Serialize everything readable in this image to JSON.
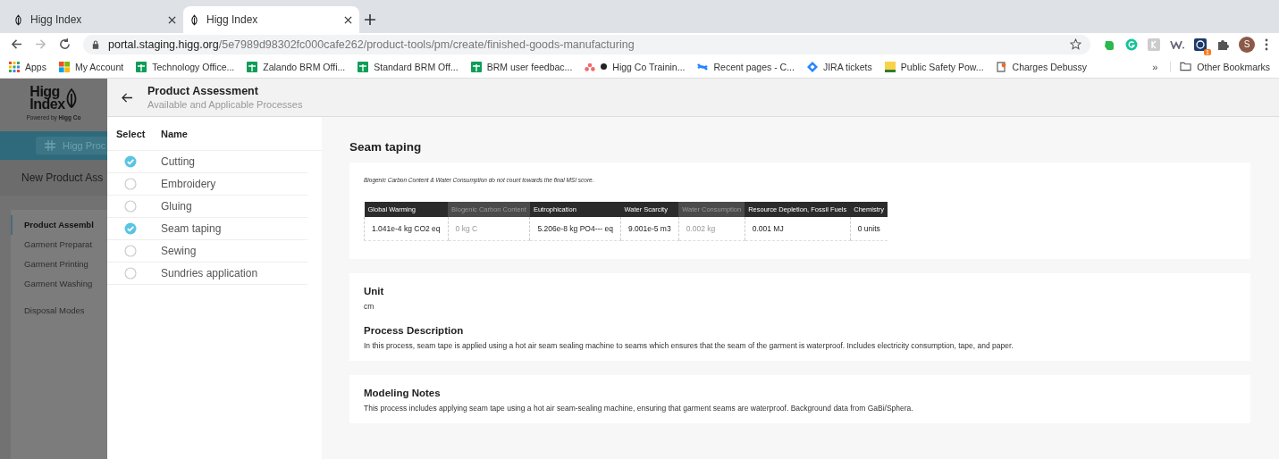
{
  "browser": {
    "tabs": [
      {
        "title": "Higg Index",
        "selected": false
      },
      {
        "title": "Higg Index",
        "selected": true
      }
    ],
    "url_host": "portal.staging.higg.org",
    "url_path": "/5e7989d98302fc000cafe262/product-tools/pm/create/finished-goods-manufacturing",
    "extension_badge": "1",
    "profile_initial": "S",
    "bookmarks": [
      {
        "label": "Apps",
        "kind": "apps"
      },
      {
        "label": "My Account",
        "kind": "windows"
      },
      {
        "label": "Technology Office...",
        "kind": "sheet"
      },
      {
        "label": "Zalando BRM Offi...",
        "kind": "sheet"
      },
      {
        "label": "Standard BRM Off...",
        "kind": "sheet"
      },
      {
        "label": "BRM user feedbac...",
        "kind": "sheet"
      },
      {
        "label": "Higg Co Trainin...",
        "kind": "asana"
      },
      {
        "label": "Recent pages - C...",
        "kind": "confluence"
      },
      {
        "label": "JIRA tickets",
        "kind": "jira"
      },
      {
        "label": "Public Safety Pow...",
        "kind": "sun"
      },
      {
        "label": "Charges Debussy",
        "kind": "doc"
      }
    ],
    "overflow": "»",
    "other_bookmarks": "Other Bookmarks"
  },
  "background_app": {
    "logo_line1": "Higg",
    "logo_line2": "Index",
    "logo_tagline": "Powered by",
    "logo_brand": "Higg Co",
    "nav_button": "Higg Proc",
    "page_title": "New Product Ass",
    "steps": [
      {
        "label": "Product Assembl",
        "selected": true
      },
      {
        "label": "Garment Preparat",
        "selected": false
      },
      {
        "label": "Garment Printing",
        "selected": false
      },
      {
        "label": "Garment Washing",
        "selected": false
      },
      {
        "label": "Disposal Modes",
        "selected": false
      }
    ]
  },
  "drawer": {
    "title": "Product Assessment",
    "subtitle": "Available and Applicable Processes",
    "columns": [
      "Select",
      "Name"
    ],
    "processes": [
      {
        "name": "Cutting",
        "selected": true
      },
      {
        "name": "Embroidery",
        "selected": false
      },
      {
        "name": "Gluing",
        "selected": false
      },
      {
        "name": "Seam taping",
        "selected": true
      },
      {
        "name": "Sewing",
        "selected": false
      },
      {
        "name": "Sundries application",
        "selected": false
      }
    ],
    "detail": {
      "title": "Seam taping",
      "note": "Biogenic Carbon Content & Water Consumption do not count towards the final MSI score.",
      "impacts": [
        {
          "header": "Global Warming",
          "value": "1.041e-4 kg CO2 eq",
          "muted": false
        },
        {
          "header": "Biogenic Carbon Content",
          "value": "0 kg C",
          "muted": true
        },
        {
          "header": "Eutrophication",
          "value": "5.206e-8 kg PO4--- eq",
          "muted": false
        },
        {
          "header": "Water Scarcity",
          "value": "9.001e-5 m3",
          "muted": false
        },
        {
          "header": "Water Consumption",
          "value": "0.002 kg",
          "muted": true
        },
        {
          "header": "Resource Depletion, Fossil Fuels",
          "value": "0.001 MJ",
          "muted": false
        },
        {
          "header": "Chemistry",
          "value": "0 units",
          "muted": false
        }
      ],
      "unit_label": "Unit",
      "unit": "cm",
      "description_label": "Process Description",
      "description": "In this process, seam tape is applied using a hot air seam sealing machine to seams which ensures that the seam of the garment is waterproof. Includes electricity consumption, tape, and paper.",
      "notes_label": "Modeling Notes",
      "notes": "This process includes applying seam tape using a hot air seam-sealing machine, ensuring that garment seams are waterproof. Background data from GaBi/Sphera."
    }
  }
}
